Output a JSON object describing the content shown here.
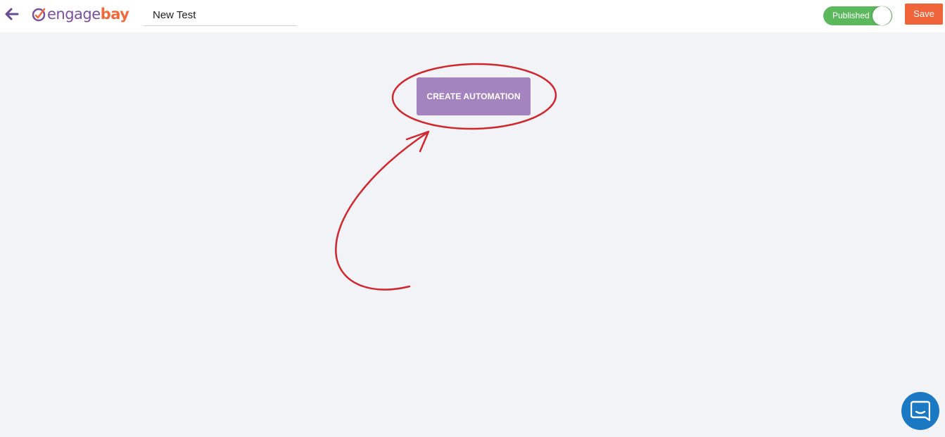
{
  "header": {
    "back_icon": "arrow-left-icon",
    "logo": {
      "part1": "engage",
      "part2": "bay",
      "colors": {
        "engage": "#7b4f9e",
        "bay": "#f06a3a"
      }
    },
    "title_value": "New Test",
    "status_toggle": {
      "label": "Published",
      "on": true,
      "color": "#5cb85c"
    },
    "save_label": "Save",
    "save_color": "#f0643a"
  },
  "main": {
    "create_automation_label": "CREATE AUTOMATION",
    "button_color": "#a484bf",
    "annotation_color": "#d0272f"
  },
  "chat": {
    "icon": "chat-bubble-icon",
    "color": "#1a79c2"
  }
}
